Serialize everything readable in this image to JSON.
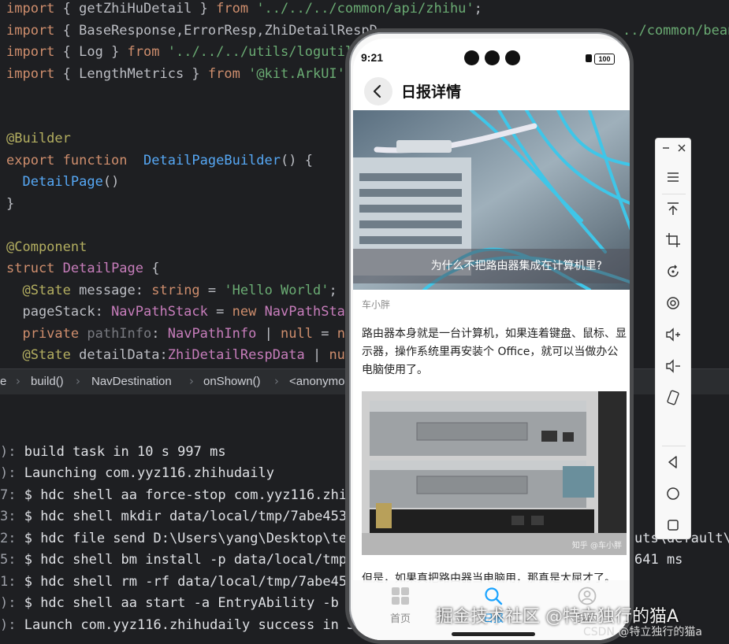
{
  "editor": {
    "lines": [
      [
        "import { getZhiHuDetail } from '../../../common/api/zhihu';"
      ],
      [
        "import { BaseResponse,ErrorResp,ZhiDetailRespD",
        "ata,ZhiDetailItem } from '../../../common/bean"
      ],
      [
        "import { Log } from '../../../utils/logutil"
      ],
      [
        "import { LengthMetrics } from '@kit.ArkUI';"
      ]
    ],
    "code": {
      "l1_kw": "import",
      "l1_a": " { getZhiHuDetail } ",
      "l1_from": "from",
      "l1_s": " '../../../common/api/zhihu'",
      "l1_e": ";",
      "l2_kw": "import",
      "l2_a": " { BaseResponse,ErrorResp,ZhiDetailRespD",
      "l2_tail": "../common/bean",
      "l3_kw": "import",
      "l3_a": " { Log } ",
      "l3_from": "from",
      "l3_s": " '../../../utils/logutil",
      "l4_kw": "import",
      "l4_a": " { LengthMetrics } ",
      "l4_from": "from",
      "l4_s": " '@kit.ArkUI'",
      "l4_e": ";",
      "l5": "@Builder",
      "l6_kw": "export function",
      "l6_fn": "  DetailPageBuilder",
      "l6_e": "() {",
      "l7_fn": "  DetailPage",
      "l7_e": "()",
      "l8": "}",
      "l9": "@Component",
      "l10_kw": "struct",
      "l10_cls": " DetailPage",
      "l10_e": " {",
      "l11_ann": "  @State",
      "l11_a": " message: ",
      "l11_ty": "string",
      "l11_b": " = ",
      "l11_s": "'Hello World'",
      "l11_e": ";",
      "l12_a": "  pageStack: ",
      "l12_ty": "NavPathStack",
      "l12_b": " = ",
      "l12_kw": "new",
      "l12_c": " NavPathStac",
      "l13_kw": "  private",
      "l13_dim": " pathInfo",
      "l13_a": ": ",
      "l13_ty": "NavPathInfo",
      "l13_b": " | ",
      "l13_kw2": "null",
      "l13_c": " = ",
      "l13_kw3": "nu",
      "l14_ann": "  @State",
      "l14_a": " detailData:",
      "l14_ty": "ZhiDetailRespData",
      "l14_b": " | ",
      "l14_kw": "nul"
    }
  },
  "breadcrumb": [
    "e",
    "build()",
    "NavDestination",
    "onShown()",
    "<anonymo"
  ],
  "console": [
    {
      "pre": "):",
      "text": " build task in 10 s 997 ms"
    },
    {
      "pre": "):",
      "text": " Launching com.yyz116.zhihudaily"
    },
    {
      "pre": "7:",
      "text": " $ hdc shell aa force-stop com.yyz116.zhihu"
    },
    {
      "pre": "3:",
      "text": " $ hdc shell mkdir data/local/tmp/7abe4531"
    },
    {
      "pre": "2:",
      "text": " $ hdc file send D:\\Users\\yang\\Desktop\\test",
      "right": "uts\\default\\e"
    },
    {
      "pre": "5:",
      "text": " $ hdc shell bm install -p data/local/tmp/7",
      "right": "641 ms"
    },
    {
      "pre": "1:",
      "text": " $ hdc shell rm -rf data/local/tmp/7abe4531"
    },
    {
      "pre": "):",
      "text": " $ hdc shell aa start -a EntryAbility -b co"
    },
    {
      "pre": "):",
      "text": " Launch com.yyz116.zhihudaily success in 3"
    }
  ],
  "phone": {
    "status_time": "9:21",
    "battery": "100",
    "nav_title": "日报详情",
    "hero_caption": "为什么不把路由器集成在计算机里?",
    "author": "车小胖",
    "paragraph1": "路由器本身就是一台计算机，如果连着键盘、鼠标、显示器，操作系统里再安装个 Office，就可以当做办公电脑使用了。",
    "photo_watermark": "知乎 @车小胖",
    "paragraph2": "但是，如果真把路由器当电脑用，那真是太屈才了。",
    "tabs": [
      {
        "label": "首页",
        "icon": "grid-icon",
        "active": false
      },
      {
        "label": "日报",
        "icon": "search-icon",
        "active": true
      },
      {
        "label": "我的",
        "icon": "profile-icon",
        "active": false
      }
    ],
    "accent": "#1aa3ff"
  },
  "toolbar": {
    "items": [
      "minimize",
      "close",
      "menu",
      "top",
      "crop",
      "rotate",
      "screenshot",
      "volume-up",
      "volume-down",
      "shake",
      "back",
      "home",
      "recent"
    ]
  },
  "watermarks": {
    "site": "掘金技术社区 @特立独行的猫A",
    "csdn": "CSDN @特立独行的猫a"
  }
}
